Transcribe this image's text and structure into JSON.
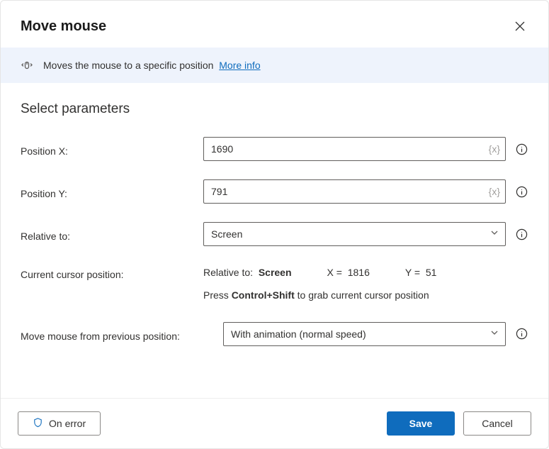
{
  "title": "Move mouse",
  "banner": {
    "text": "Moves the mouse to a specific position",
    "link": "More info"
  },
  "section_heading": "Select parameters",
  "params": {
    "position_x": {
      "label": "Position X:",
      "value": "1690"
    },
    "position_y": {
      "label": "Position Y:",
      "value": "791"
    },
    "relative_to": {
      "label": "Relative to:",
      "value": "Screen"
    },
    "current_cursor": {
      "label": "Current cursor position:",
      "relative_label": "Relative to:",
      "relative_value": "Screen",
      "x_label": "X =",
      "x_value": "1816",
      "y_label": "Y =",
      "y_value": "51",
      "hint_prefix": "Press ",
      "hint_keys": "Control+Shift",
      "hint_suffix": " to grab current cursor position"
    },
    "move_mode": {
      "label": "Move mouse from previous position:",
      "value": "With animation (normal speed)"
    }
  },
  "footer": {
    "on_error": "On error",
    "save": "Save",
    "cancel": "Cancel"
  }
}
